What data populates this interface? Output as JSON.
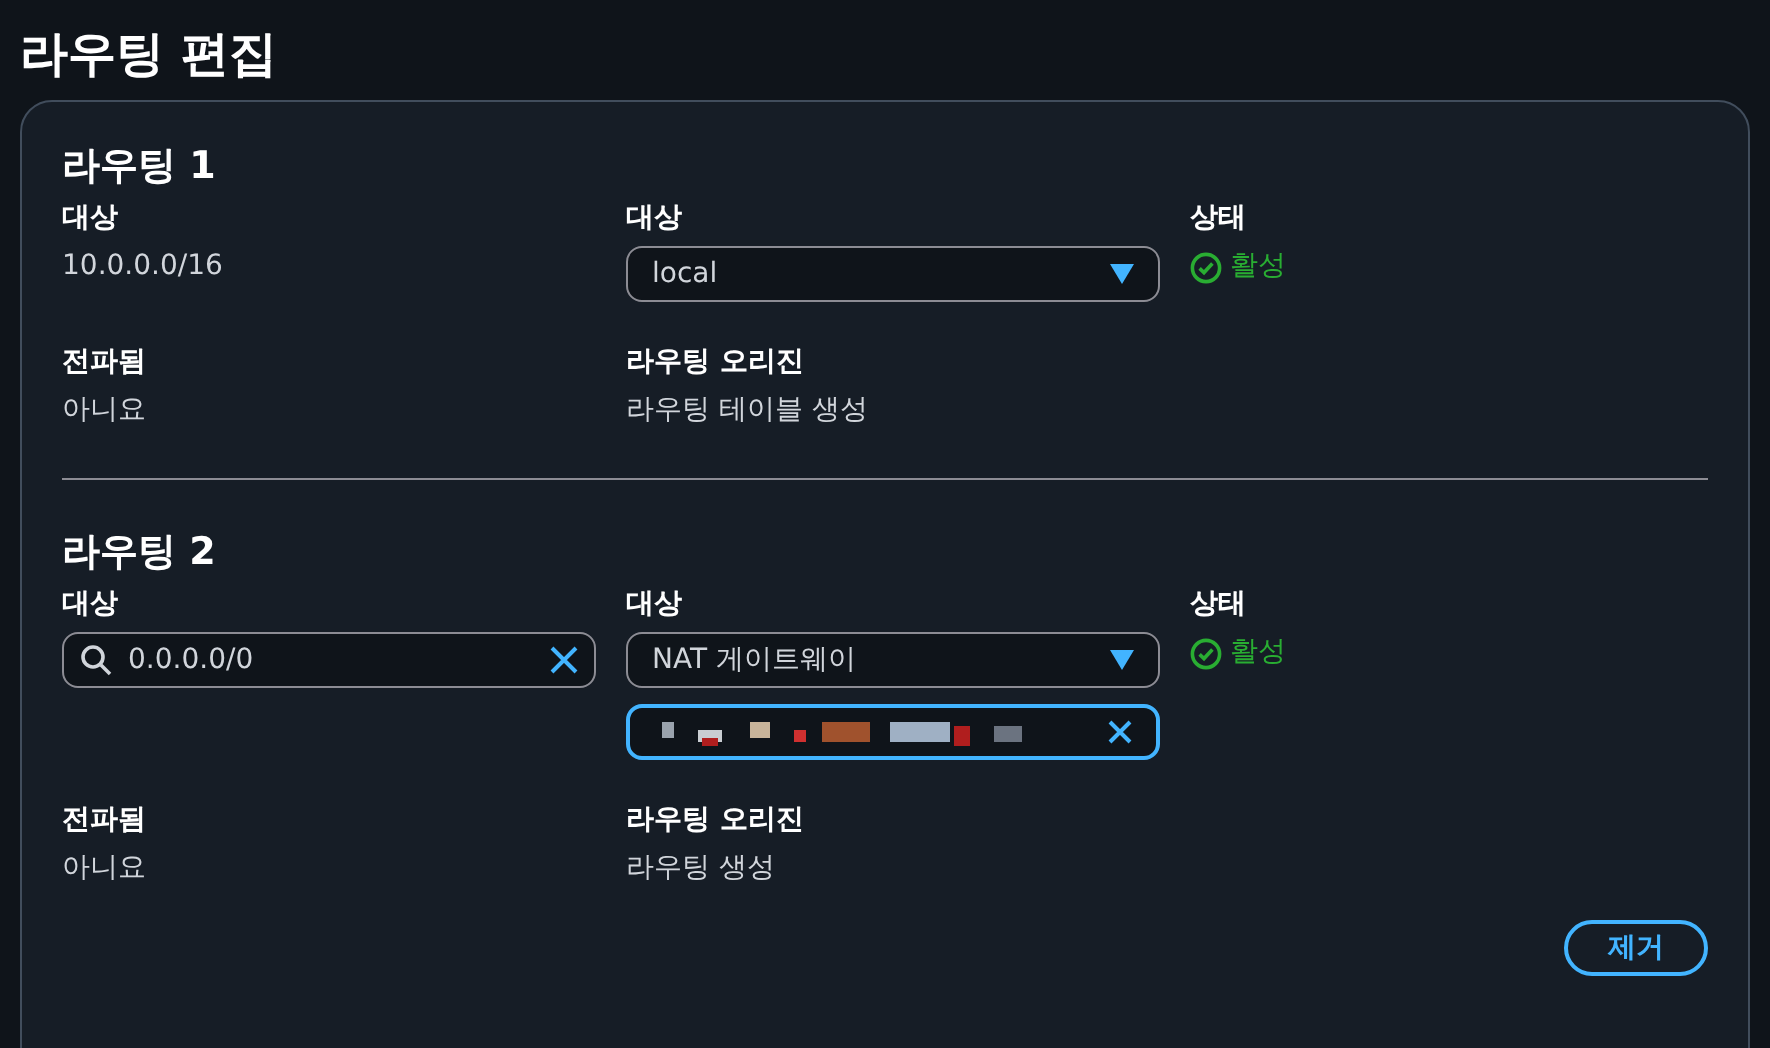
{
  "page_title": "라우팅 편집",
  "routes": [
    {
      "title": "라우팅 1",
      "destination_label": "대상",
      "destination": {
        "kind": "text",
        "value": "10.0.0.0/16"
      },
      "target_label": "대상",
      "target": "local",
      "status_label": "상태",
      "status": "활성",
      "propagated_label": "전파됨",
      "propagated": "아니요",
      "origin_label": "라우팅 오리진",
      "origin": "라우팅 테이블 생성"
    },
    {
      "title": "라우팅 2",
      "destination_label": "대상",
      "destination": {
        "kind": "search",
        "value": "0.0.0.0/0"
      },
      "target_label": "대상",
      "target": "NAT 게이트웨이",
      "target_id_field": true,
      "status_label": "상태",
      "status": "활성",
      "propagated_label": "전파됨",
      "propagated": "아니요",
      "origin_label": "라우팅 오리진",
      "origin": "라우팅 생성",
      "remove_button": "제거"
    }
  ]
}
